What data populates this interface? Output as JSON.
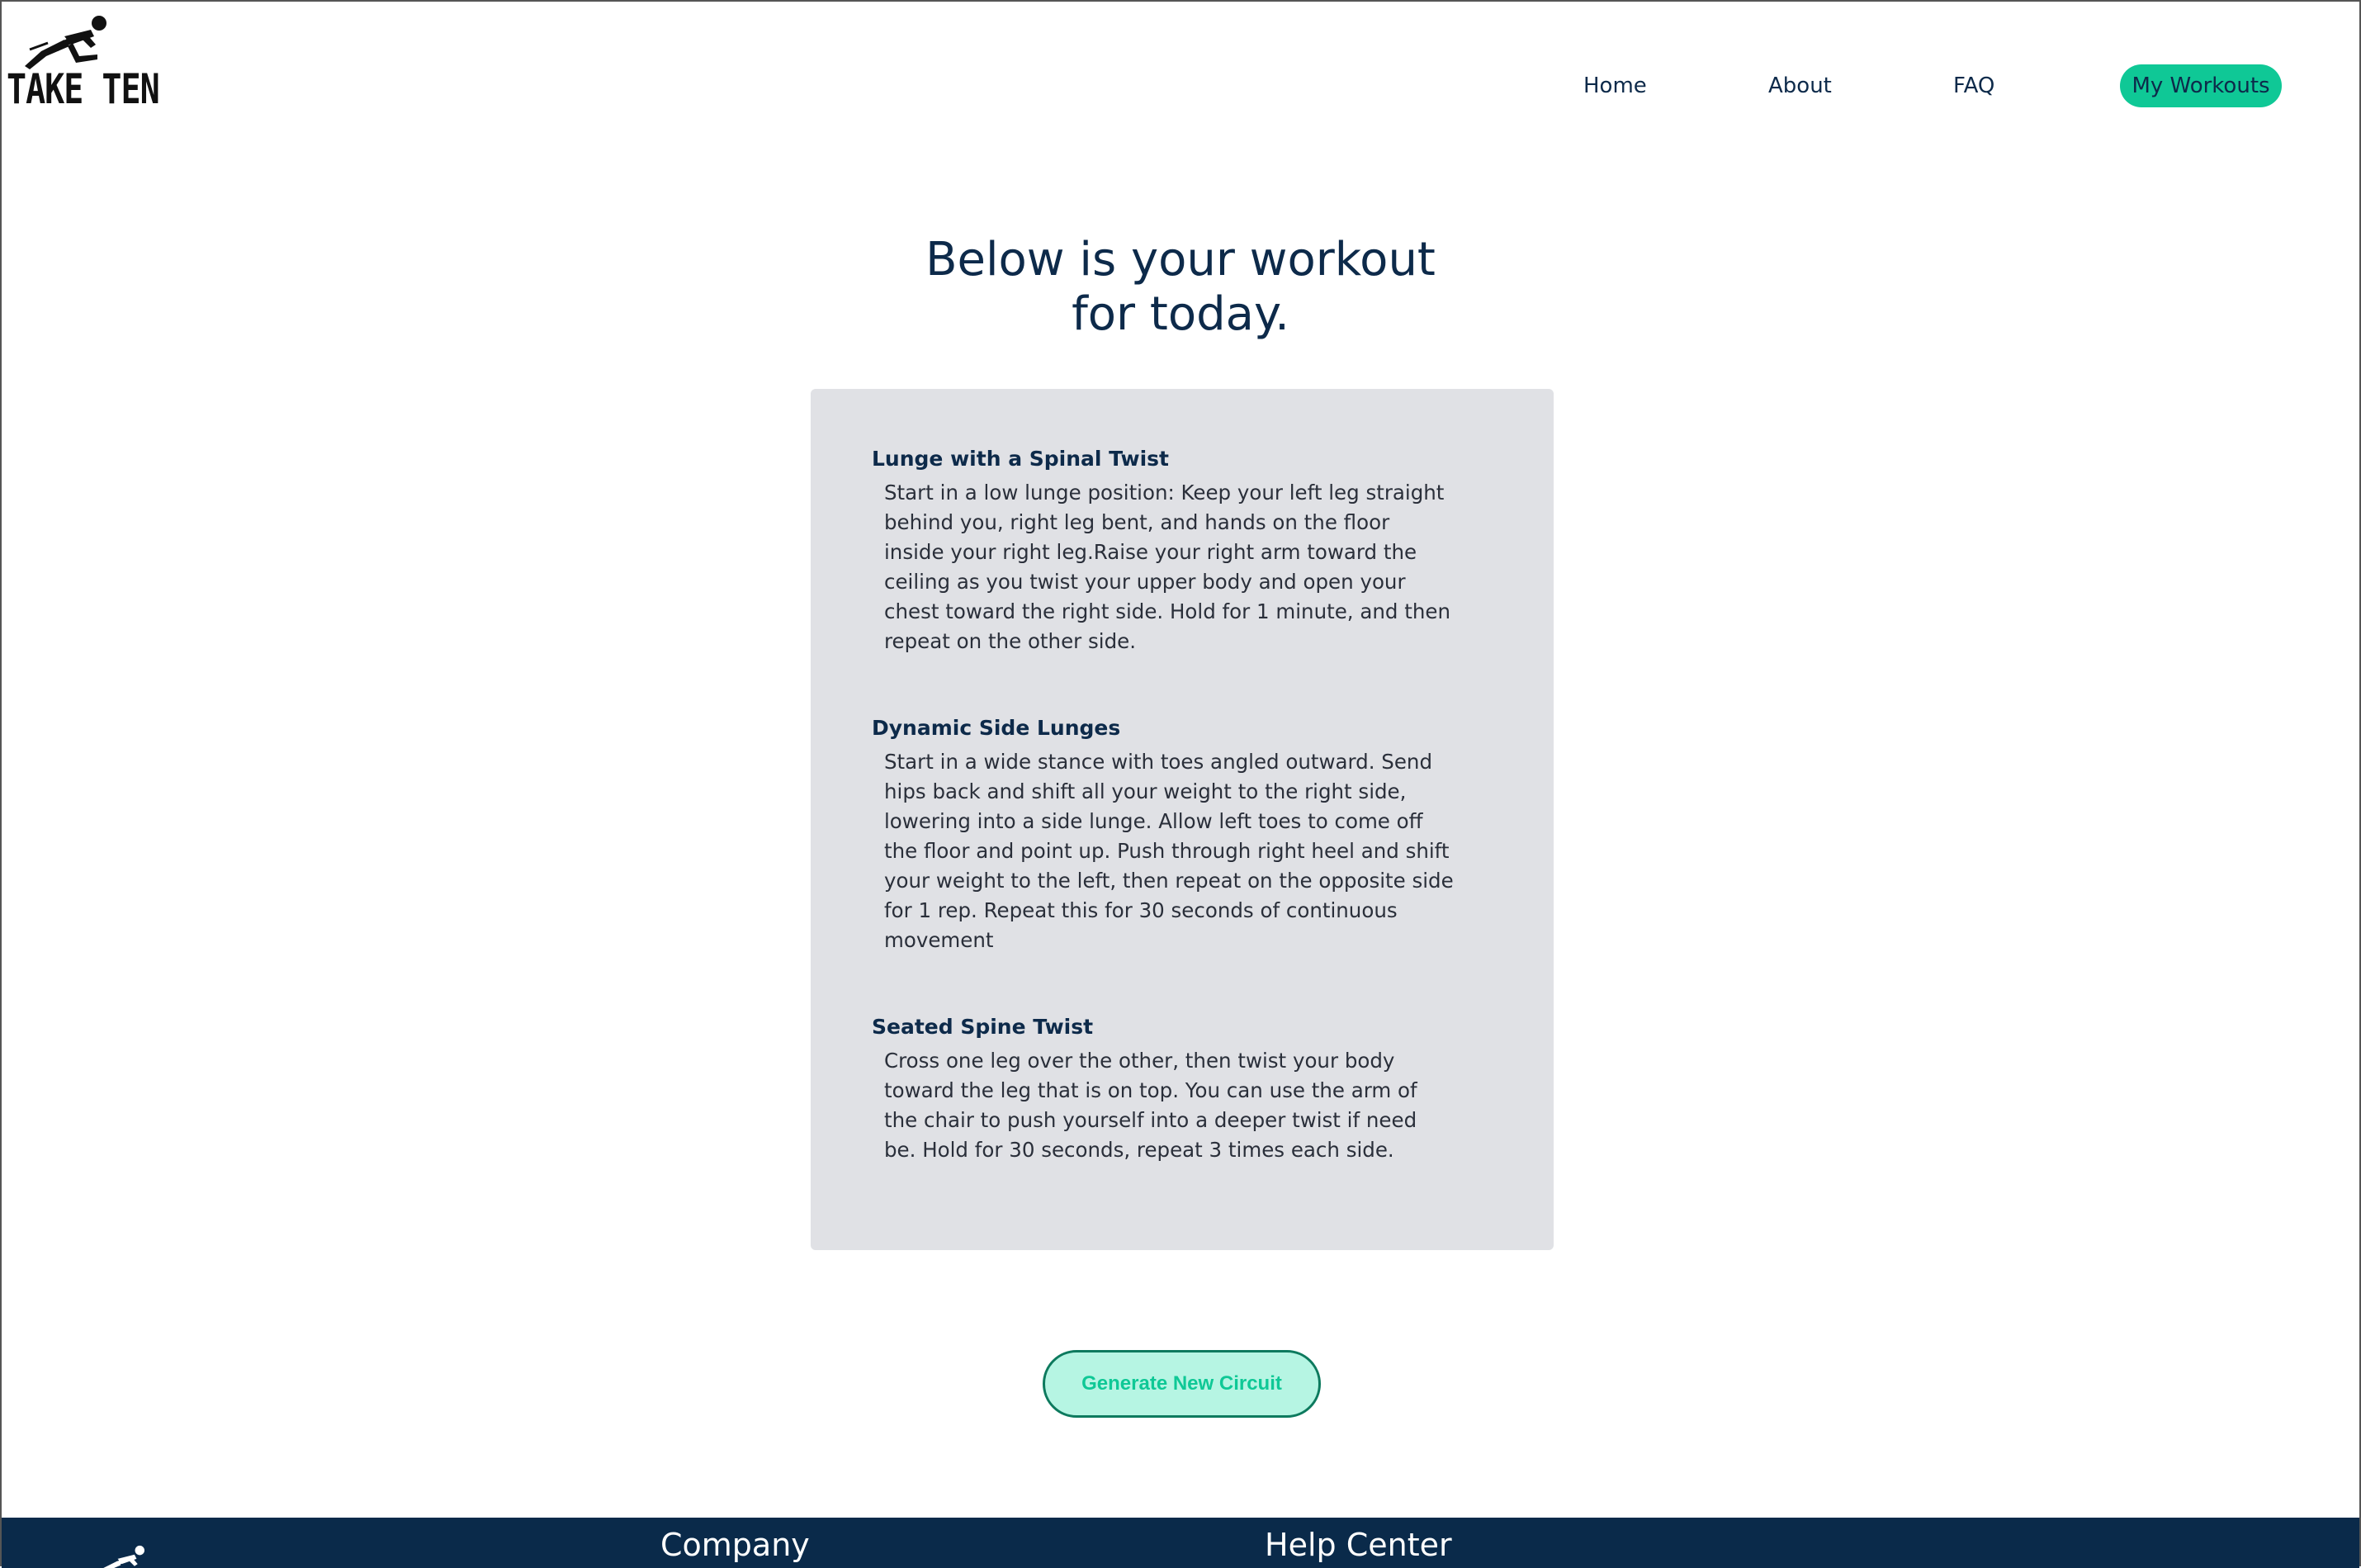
{
  "brand": {
    "name": "TAKE TEN",
    "logo_icon": "running-figure-icon"
  },
  "nav": {
    "items": [
      {
        "label": "Home"
      },
      {
        "label": "About"
      },
      {
        "label": "FAQ"
      },
      {
        "label": "My Workouts",
        "active": true
      }
    ],
    "active_color": "#0fc896"
  },
  "main": {
    "title_line1": "Below is your workout",
    "title_line2": "for today.",
    "exercises": [
      {
        "name": "Lunge with a Spinal Twist",
        "description": "Start in a low lunge position: Keep your left leg straight behind you, right leg bent, and hands on the floor inside your right leg.Raise your right arm toward the ceiling as you twist your upper body and open your chest toward the right side. Hold for 1 minute, and then repeat on the other side."
      },
      {
        "name": "Dynamic Side Lunges",
        "description": "Start in a wide stance with toes angled outward. Send hips back and shift all your weight to the right side, lowering into a side lunge. Allow left toes to come off the floor and point up. Push through right heel and shift your weight to the left, then repeat on the opposite side for 1 rep. Repeat this for 30 seconds of continuous movement"
      },
      {
        "name": "Seated Spine Twist",
        "description": "Cross one leg over the other, then twist your body toward the leg that is on top. You can use the arm of the chair to push yourself into a deeper twist if need be. Hold for 30 seconds, repeat 3 times each side."
      }
    ],
    "generate_button_label": "Generate New Circuit"
  },
  "footer": {
    "company_heading": "Company",
    "help_heading": "Help Center",
    "background_color": "#0a2a4a"
  }
}
